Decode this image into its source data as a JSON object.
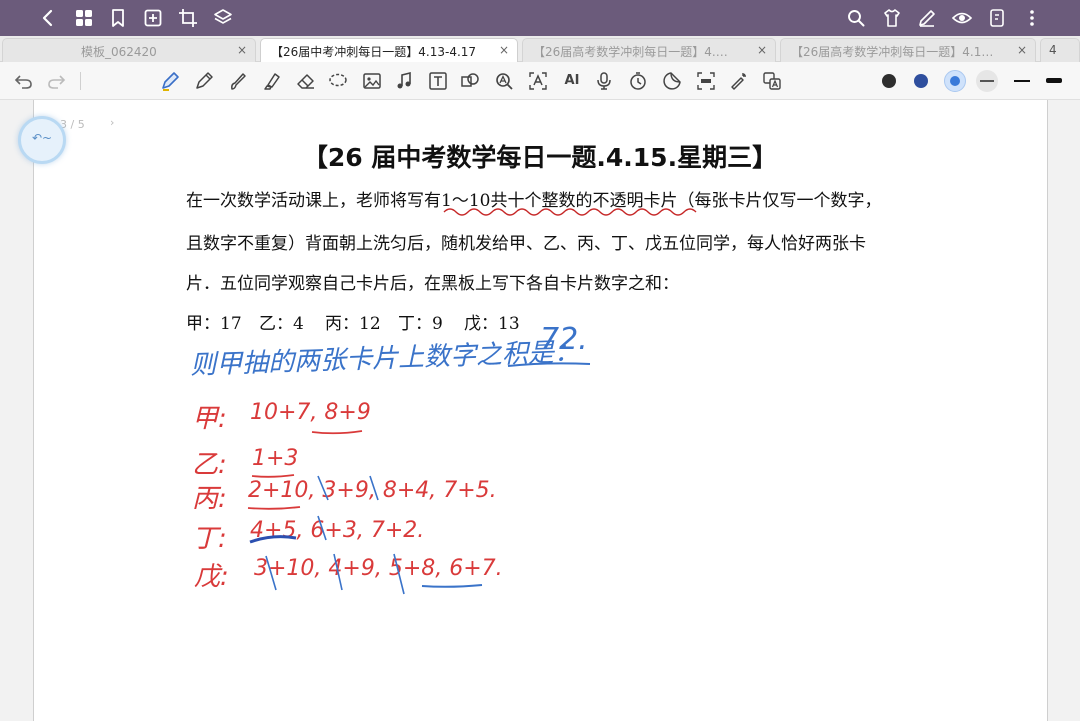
{
  "tabs": [
    {
      "label": "模板_062420",
      "close": "×"
    },
    {
      "label": "【26届中考冲刺每日一题】4.13-4.17",
      "close": "×"
    },
    {
      "label": "【26届高考数学冲刺每日一题】4.…",
      "close": "×"
    },
    {
      "label": "【26届高考数学冲刺每日一题】4.1…",
      "close": "×"
    },
    {
      "label": "4",
      "close": ""
    }
  ],
  "toolbar": {
    "ai_label": "AI"
  },
  "pager": {
    "prev": "‹",
    "page": "3 / 5",
    "next": "›"
  },
  "document": {
    "title": "【26 届中考数学每日一题.4.15.星期三】",
    "line1": "在一次数学活动课上，老师将写有1～10共十个整数的不透明卡片（每张卡片仅写一个数字，",
    "line2": "且数字不重复）背面朝上洗匀后，随机发给甲、乙、丙、丁、戊五位同学，每人恰好两张卡",
    "line3": "片．五位同学观察自己卡片后，在黑板上写下各自卡片数字之和：",
    "scores": [
      "甲：17",
      "乙：4",
      "丙：12",
      "丁：9",
      "戊：13"
    ]
  },
  "handwriting": {
    "question": "则甲抽的两张卡片上数字之积是：",
    "answer": "72.",
    "rows": [
      {
        "label": "甲:",
        "text": "10+7,  8+9"
      },
      {
        "label": "乙:",
        "text": "1+3"
      },
      {
        "label": "丙:",
        "text": "2+10, 3+9, 8+4, 7+5."
      },
      {
        "label": "丁:",
        "text": "4+5, 6+3, 7+2."
      },
      {
        "label": "戊:",
        "text": "3+10, 4+9, 5+8, 6+7."
      }
    ]
  },
  "colors": {
    "topbar": "#6b5b7b",
    "ink_blue": "#3a73c9",
    "ink_red": "#d93a3a",
    "ink_darkblue": "#2b4fb0"
  }
}
